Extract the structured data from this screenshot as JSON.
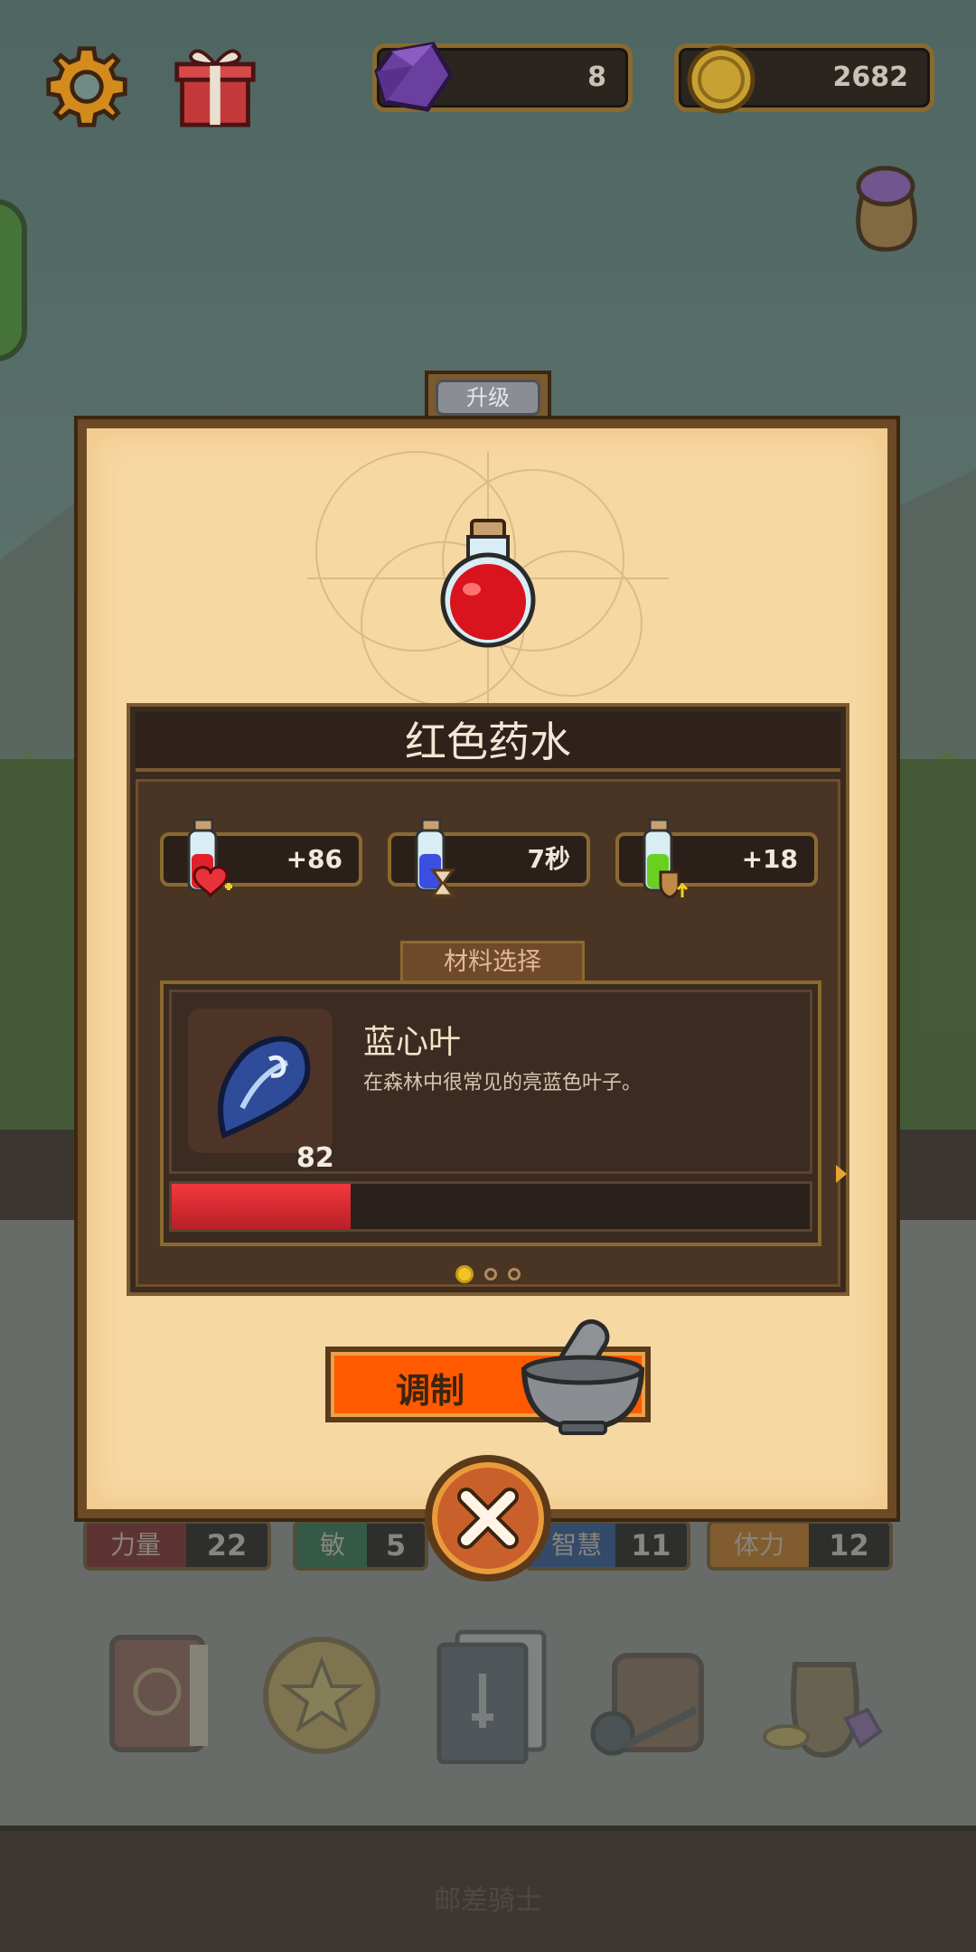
{
  "hud": {
    "gems": "8",
    "coins": "2682"
  },
  "dialog": {
    "tab_label": "升级",
    "item_name": "红色药水",
    "effects": [
      {
        "icon": "health-potion-icon",
        "value": "+86"
      },
      {
        "icon": "mana-potion-hourglass-icon",
        "value": "7秒"
      },
      {
        "icon": "green-potion-shield-icon",
        "value": "+18"
      }
    ],
    "material_tab": "材料选择",
    "material": {
      "name": "蓝心叶",
      "description": "在森林中很常见的亮蓝色叶子。",
      "count": "82",
      "progress": 0.28
    },
    "page_dots": 3,
    "active_dot": 0,
    "brew_label": "调制"
  },
  "stats": [
    {
      "label": "力量",
      "value": "22",
      "color": "#7a2326"
    },
    {
      "label": "敏捷",
      "value": "5",
      "color": "#2f6a48"
    },
    {
      "label": "智慧",
      "value": "11",
      "color": "#2d4f86"
    },
    {
      "label": "体力",
      "value": "12",
      "color": "#b86d1a"
    }
  ],
  "menu_icons": [
    "book-icon",
    "star-coin-icon",
    "cards-icon",
    "backpack-icon",
    "treasure-bag-icon"
  ],
  "footer": {
    "text": "邮差骑士"
  },
  "colors": {
    "parchment": "#f6d8a3",
    "panel_dark": "#3a2a1f",
    "accent_orange": "#ff5a00",
    "progress_red": "#f3383e",
    "gold": "#f2c326"
  }
}
